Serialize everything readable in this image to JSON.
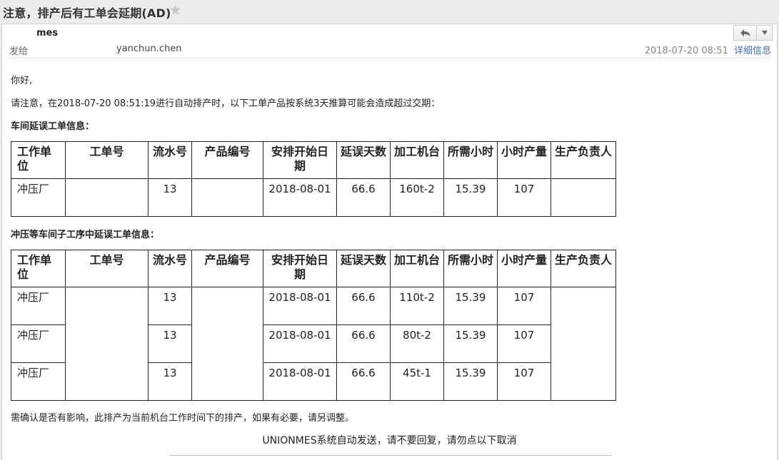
{
  "subject": "注意，排产后有工单会延期(AD)",
  "header": {
    "from_name": "mes",
    "to_label": "发给",
    "to_value": "yanchun.chen",
    "date": "2018-07-20 08:51",
    "details_link": "详细信息",
    "reply_icon": "reply-icon",
    "more_icon": "chevron-down-icon"
  },
  "body": {
    "greeting": "你好,",
    "intro": "请注意，在2018-07-20 08:51:19进行自动排产时，以下工单产品按系统3天推算可能会造成超过交期：",
    "section1_title": "车间延误工单信息：",
    "section2_title": "冲压等车间子工序中延误工单信息：",
    "note": "需确认是否有影响，此排产为当前机台工作时间下的排产，如果有必要，请另调整。",
    "footer": "UNIONMES系统自动发送，请不要回复，请勿点以下取消"
  },
  "columns": [
    "工作单位",
    "工单号",
    "流水号",
    "产品编号",
    "安排开始日期",
    "延误天数",
    "加工机台",
    "所需小时",
    "小时产量",
    "生产负责人"
  ],
  "table1": {
    "rows": [
      [
        "冲压厂",
        "",
        "13",
        "",
        "2018-08-01",
        "66.6",
        "160t-2",
        "15.39",
        "107",
        ""
      ]
    ]
  },
  "table2": {
    "rows": [
      [
        "冲压厂",
        "",
        "13",
        "",
        "2018-08-01",
        "66.6",
        "110t-2",
        "15.39",
        "107",
        ""
      ],
      [
        "冲压厂",
        "",
        "13",
        "",
        "2018-08-01",
        "66.6",
        "80t-2",
        "15.39",
        "107",
        ""
      ],
      [
        "冲压厂",
        "",
        "13",
        "",
        "2018-08-01",
        "66.6",
        "45t-1",
        "15.39",
        "107",
        ""
      ]
    ]
  },
  "colors": {
    "link": "#3d6fb5",
    "star": "#c8c8c8",
    "background": "#ececec"
  }
}
